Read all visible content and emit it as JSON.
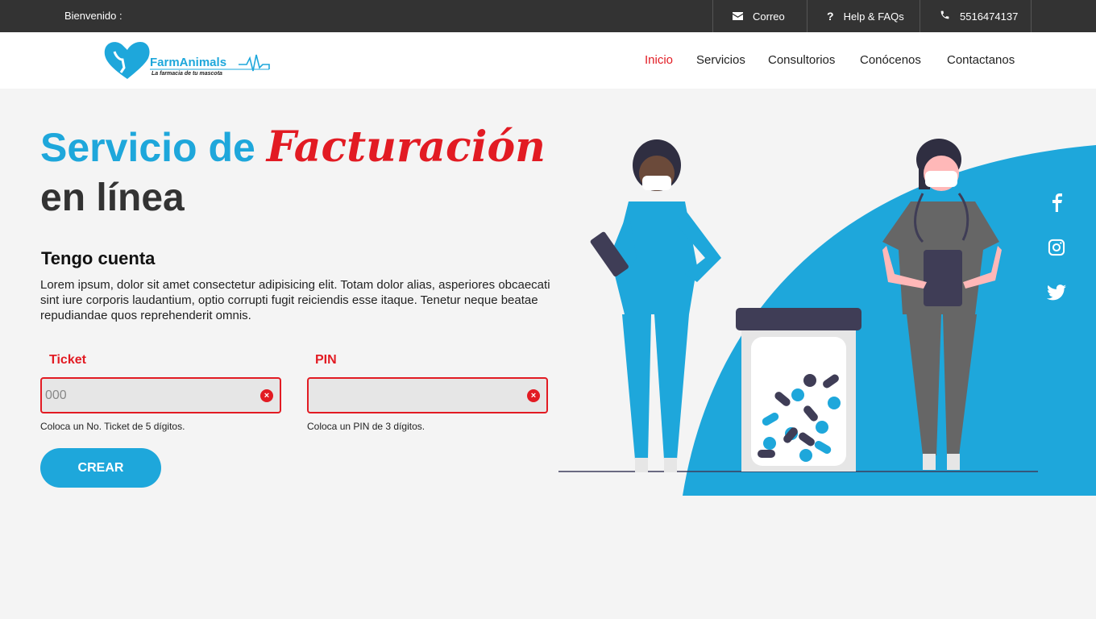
{
  "topbar": {
    "welcome": "Bienvenido :",
    "mail_label": "Correo",
    "help_label": "Help & FAQs",
    "phone_label": "5516474137"
  },
  "header": {
    "logo_brand": "FarmAnimals",
    "logo_tagline": "La farmacia de tu mascota",
    "nav": [
      "Inicio",
      "Servicios",
      "Consultorios",
      "Conócenos",
      "Contactanos"
    ],
    "active_nav": "Inicio"
  },
  "hero": {
    "title_part1": "Servicio de",
    "title_accent": "Facturación",
    "title_part2": "en línea",
    "subtitle": "Tengo cuenta",
    "description": "Lorem ipsum, dolor sit amet consectetur adipisicing elit. Totam dolor alias, asperiores obcaecati sint iure corporis laudantium, optio corrupti fugit reiciendis esse itaque. Tenetur neque beatae repudiandae quos reprehenderit omnis."
  },
  "form": {
    "ticket_label": "Ticket",
    "ticket_placeholder": "000",
    "ticket_value": "",
    "ticket_hint": "Coloca un No. Ticket de 5 dígitos.",
    "pin_label": "PIN",
    "pin_placeholder": "",
    "pin_value": "",
    "pin_hint": "Coloca un PIN de 3 dígitos.",
    "submit_label": "CREAR"
  },
  "social": [
    "facebook-icon",
    "instagram-icon",
    "twitter-icon"
  ],
  "colors": {
    "brand_blue": "#1ea7db",
    "accent_red": "#e21b23",
    "topbar_bg": "#333333"
  }
}
